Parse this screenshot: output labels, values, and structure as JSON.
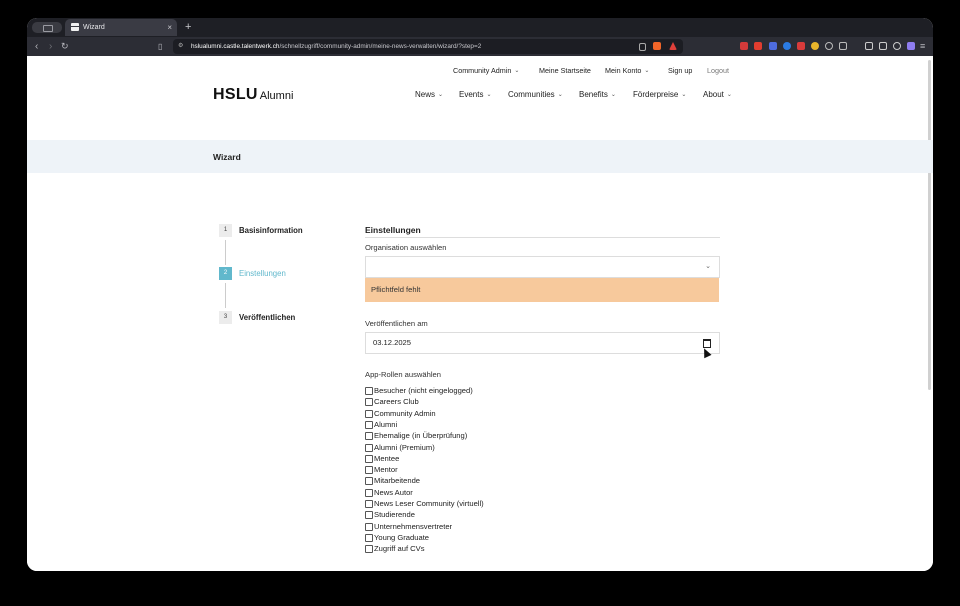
{
  "browser": {
    "tab_title": "Wizard",
    "tab_close": "×",
    "new_tab": "+",
    "url_domain": "hslualumni.castle.talentwerk.ch",
    "url_path": "/schnellzugriff/community-admin/meine-news-verwalten/wizard/?step=2"
  },
  "site": {
    "logo_main": "HSLU",
    "logo_sub": "Alumni",
    "top_nav": [
      {
        "label": "Community Admin",
        "has_dropdown": true
      },
      {
        "label": "Meine Startseite",
        "has_dropdown": false
      },
      {
        "label": "Mein Konto",
        "has_dropdown": true
      },
      {
        "label": "Sign up",
        "has_dropdown": false
      },
      {
        "label": "Logout",
        "has_dropdown": false
      }
    ],
    "main_nav": [
      {
        "label": "News"
      },
      {
        "label": "Events"
      },
      {
        "label": "Communities"
      },
      {
        "label": "Benefits"
      },
      {
        "label": "Förderpreise"
      },
      {
        "label": "About"
      }
    ]
  },
  "band_title": "Wizard",
  "steps": [
    {
      "number": "1",
      "label": "Basisinformation",
      "active": false
    },
    {
      "number": "2",
      "label": "Einstellungen",
      "active": true
    },
    {
      "number": "3",
      "label": "Veröffentlichen",
      "active": false
    }
  ],
  "form": {
    "title": "Einstellungen",
    "org_label": "Organisation auswählen",
    "org_value": "",
    "error_text": "Pflichtfeld fehlt",
    "publish_label": "Veröffentlichen am",
    "publish_value": "03.12.2025",
    "roles_label": "App-Rollen auswählen",
    "roles": [
      {
        "label": "Besucher (nicht eingelogged)",
        "checked": false
      },
      {
        "label": "Careers Club",
        "checked": false
      },
      {
        "label": "Community Admin",
        "checked": false
      },
      {
        "label": "Alumni",
        "checked": false
      },
      {
        "label": "Ehemalige (in Überprüfung)",
        "checked": false
      },
      {
        "label": "Alumni (Premium)",
        "checked": false
      },
      {
        "label": "Mentee",
        "checked": false
      },
      {
        "label": "Mentor",
        "checked": false
      },
      {
        "label": "Mitarbeitende",
        "checked": false
      },
      {
        "label": "News Autor",
        "checked": false
      },
      {
        "label": "News Leser Community (virtuell)",
        "checked": false
      },
      {
        "label": "Studierende",
        "checked": false
      },
      {
        "label": "Unternehmensvertreter",
        "checked": false
      },
      {
        "label": "Young Graduate",
        "checked": false
      },
      {
        "label": "Zugriff auf CVs",
        "checked": false
      }
    ]
  },
  "colors": {
    "accent": "#61b8cc",
    "error_bg": "#f7c99c",
    "band_bg": "#eef3f8"
  }
}
